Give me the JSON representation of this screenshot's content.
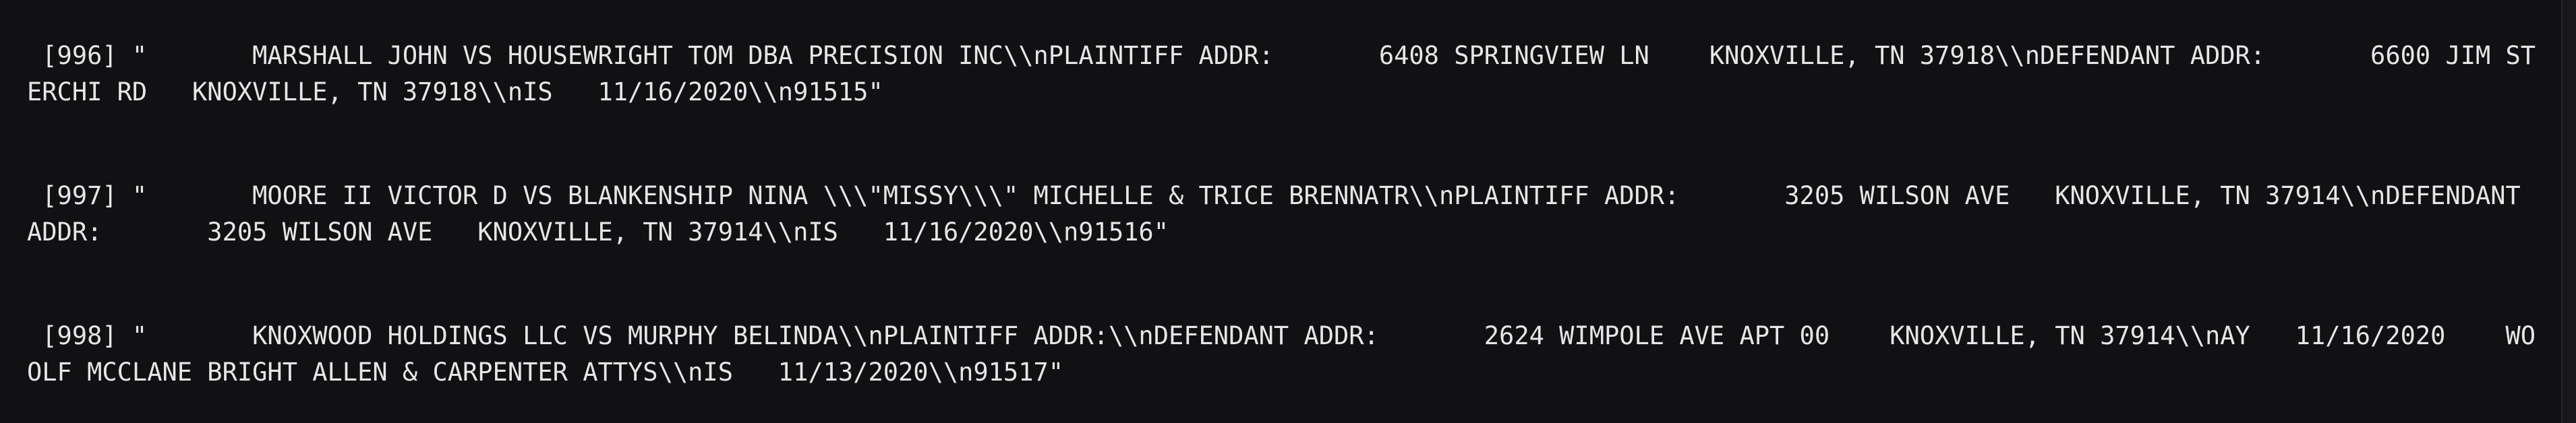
{
  "terminal": {
    "records": [
      "[996] \"       MARSHALL JOHN VS HOUSEWRIGHT TOM DBA PRECISION INC\\\\nPLAINTIFF ADDR:       6408 SPRINGVIEW LN    KNOXVILLE, TN 37918\\\\nDEFENDANT ADDR:       6600 JIM STERCHI RD   KNOXVILLE, TN 37918\\\\nIS   11/16/2020\\\\n91515\"",
      "[997] \"       MOORE II VICTOR D VS BLANKENSHIP NINA \\\\\\\"MISSY\\\\\\\" MICHELLE & TRICE BRENNATR\\\\nPLAINTIFF ADDR:       3205 WILSON AVE   KNOXVILLE, TN 37914\\\\nDEFENDANT ADDR:       3205 WILSON AVE   KNOXVILLE, TN 37914\\\\nIS   11/16/2020\\\\n91516\"",
      "[998] \"       KNOXWOOD HOLDINGS LLC VS MURPHY BELINDA\\\\nPLAINTIFF ADDR:\\\\nDEFENDANT ADDR:       2624 WIMPOLE AVE APT 00    KNOXVILLE, TN 37914\\\\nAY   11/16/2020    WOOLF MCCLANE BRIGHT ALLEN & CARPENTER ATTYS\\\\nIS   11/13/2020\\\\n91517\""
    ]
  }
}
